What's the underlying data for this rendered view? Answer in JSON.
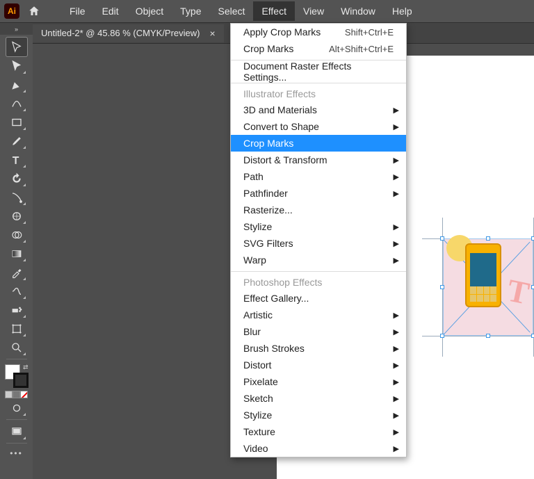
{
  "menubar": {
    "items": [
      "File",
      "Edit",
      "Object",
      "Type",
      "Select",
      "Effect",
      "View",
      "Window",
      "Help"
    ],
    "active_index": 5
  },
  "doctab": {
    "label": "Untitled-2* @ 45.86 % (CMYK/Preview)"
  },
  "effect_menu": {
    "top": [
      {
        "label": "Apply Crop Marks",
        "shortcut": "Shift+Ctrl+E"
      },
      {
        "label": "Crop Marks",
        "shortcut": "Alt+Shift+Ctrl+E"
      }
    ],
    "raster": "Document Raster Effects Settings...",
    "section_illustrator": "Illustrator Effects",
    "illustrator": [
      {
        "label": "3D and Materials",
        "sub": true
      },
      {
        "label": "Convert to Shape",
        "sub": true
      },
      {
        "label": "Crop Marks",
        "sub": false,
        "selected": true
      },
      {
        "label": "Distort & Transform",
        "sub": true
      },
      {
        "label": "Path",
        "sub": true
      },
      {
        "label": "Pathfinder",
        "sub": true
      },
      {
        "label": "Rasterize...",
        "sub": false
      },
      {
        "label": "Stylize",
        "sub": true
      },
      {
        "label": "SVG Filters",
        "sub": true
      },
      {
        "label": "Warp",
        "sub": true
      }
    ],
    "section_photoshop": "Photoshop Effects",
    "photoshop": [
      {
        "label": "Effect Gallery...",
        "sub": false
      },
      {
        "label": "Artistic",
        "sub": true
      },
      {
        "label": "Blur",
        "sub": true
      },
      {
        "label": "Brush Strokes",
        "sub": true
      },
      {
        "label": "Distort",
        "sub": true
      },
      {
        "label": "Pixelate",
        "sub": true
      },
      {
        "label": "Sketch",
        "sub": true
      },
      {
        "label": "Stylize",
        "sub": true
      },
      {
        "label": "Texture",
        "sub": true
      },
      {
        "label": "Video",
        "sub": true
      }
    ]
  },
  "tools": [
    "selection",
    "direct-selection",
    "pen",
    "curvature",
    "rectangle",
    "paintbrush",
    "type",
    "rotate",
    "eyedropper-shape",
    "width",
    "shape-builder",
    "mesh",
    "eyedropper",
    "gradient",
    "symbol-sprayer",
    "artboard",
    "zoom"
  ]
}
